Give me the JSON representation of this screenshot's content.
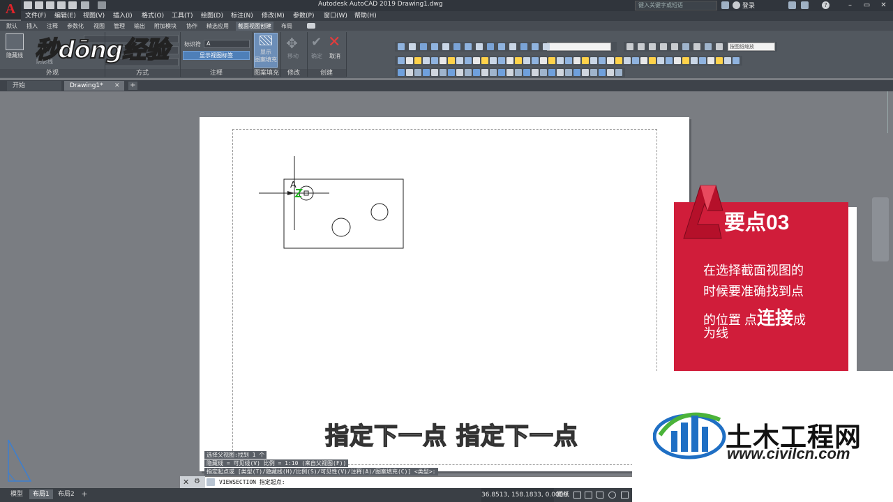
{
  "title_bar": {
    "logo_letter": "A",
    "title": "Autodesk AutoCAD 2019    Drawing1.dwg",
    "search_placeholder": "键入关键字或短语",
    "login_label": "登录",
    "help_label": "?"
  },
  "menu": {
    "items": [
      "文件(F)",
      "编辑(E)",
      "视图(V)",
      "插入(I)",
      "格式(O)",
      "工具(T)",
      "绘图(D)",
      "标注(N)",
      "修改(M)",
      "参数(P)",
      "窗口(W)",
      "帮助(H)"
    ]
  },
  "ribbon_tabs": {
    "items": [
      "默认",
      "插入",
      "注释",
      "参数化",
      "视图",
      "管理",
      "输出",
      "附加模块",
      "协作",
      "精选应用",
      "截面视图创建",
      "布局"
    ],
    "active_index": 10
  },
  "ribbon": {
    "hidden_line_label": "隐藏线",
    "shadow_label": "阴影线",
    "panels": [
      "外观",
      "方式",
      "注释",
      "图案填充",
      "修改",
      "创建"
    ],
    "identifier_label": "标识符",
    "identifier_value": "A",
    "show_view_label_button": "显示视图标签",
    "show_hatch_label": "显示",
    "show_hatch_label2": "图案填充",
    "move_label": "移动",
    "confirm_label": "确定",
    "cancel_label": "取消",
    "scale_combo": "按图纸缩放"
  },
  "brand_watermark": "秒dōng经验",
  "file_tabs": {
    "start": "开始",
    "drawing": "Drawing1*",
    "close_symbol": "✕",
    "add_symbol": "+"
  },
  "drawing": {
    "section_label": "A"
  },
  "card": {
    "heading": "要点03",
    "line1": "在选择截面视图的",
    "line2": "时候要准确找到点",
    "line3a": "的位置 点",
    "line3b": "连接",
    "line3c": "成",
    "line4": "为线",
    "color_primary": "#d01d3a"
  },
  "subtitle": "指定下一点 指定下一点",
  "command": {
    "history": [
      "选择父视图:找到 1 个",
      "隐藏线 = 可见线(V) 比例 = 1:10 (来自父视图(F))",
      "指定起点或 [类型(T)/隐藏线(H)/比例(S)/可见性(V)/注释(A)/图案填充(C)] <类型>:"
    ],
    "current": "VIEWSECTION 指定起点:"
  },
  "status_bar": {
    "layout_tabs": [
      "模型",
      "布局1",
      "布局2"
    ],
    "active_layout": 1,
    "coordinates": "36.8513, 158.1833, 0.0000",
    "space_label": "图纸"
  },
  "watermark": {
    "title": "土木工程网",
    "url": "www.civilcn.com",
    "blue": "#1f6fc4",
    "green": "#4bb33a"
  }
}
